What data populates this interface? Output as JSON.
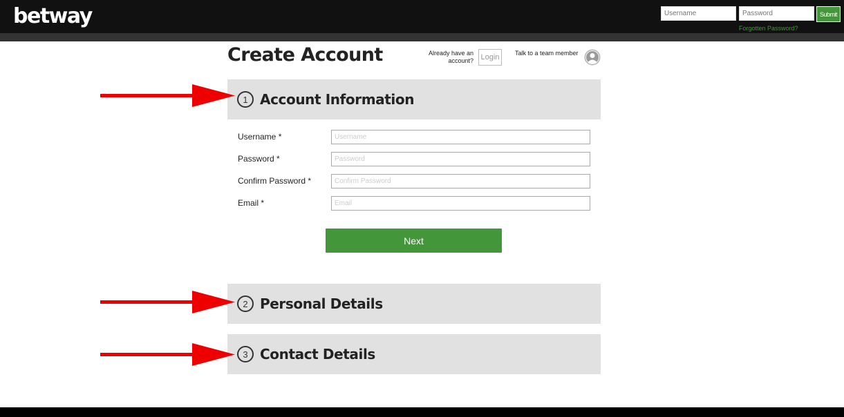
{
  "header": {
    "logo": "betway",
    "username_placeholder": "Username",
    "password_placeholder": "Password",
    "submit_label": "Submit",
    "forgot_label": "Forgotten Password?"
  },
  "page": {
    "title": "Create Account",
    "already_have_account": "Already have an account?",
    "login_label": "Login",
    "talk_label": "Talk to a team member"
  },
  "sections": [
    {
      "number": "1",
      "title": "Account Information"
    },
    {
      "number": "2",
      "title": "Personal Details"
    },
    {
      "number": "3",
      "title": "Contact Details"
    }
  ],
  "form": {
    "fields": [
      {
        "label": "Username *",
        "placeholder": "Username",
        "value": ""
      },
      {
        "label": "Password *",
        "placeholder": "Password",
        "value": ""
      },
      {
        "label": "Confirm Password *",
        "placeholder": "Confirm Password",
        "value": ""
      },
      {
        "label": "Email *",
        "placeholder": "Email",
        "value": ""
      }
    ],
    "next_label": "Next"
  },
  "colors": {
    "brand_green": "#43963a",
    "annotation_arrow": "#ee0000",
    "section_bg": "#e1e1e1"
  }
}
